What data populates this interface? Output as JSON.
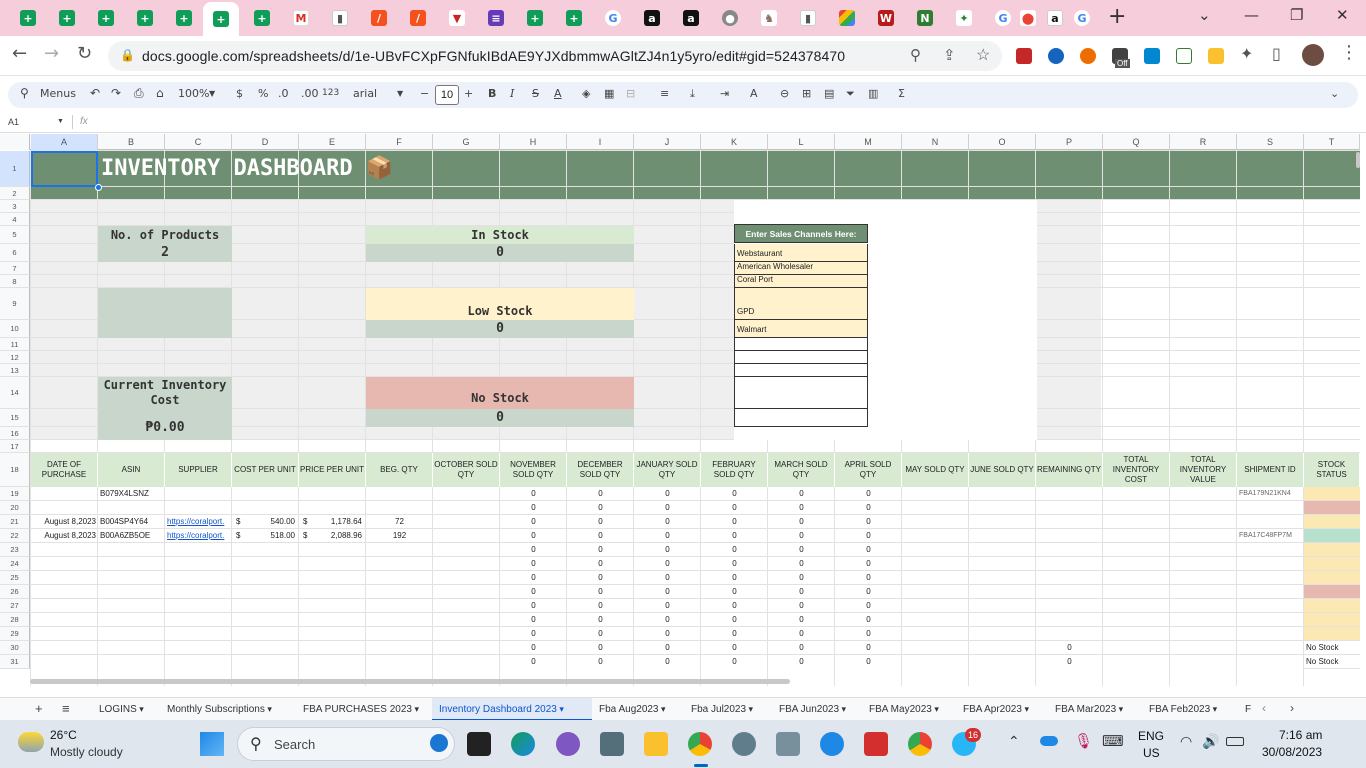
{
  "browser": {
    "url": "docs.google.com/spreadsheets/d/1e-UBvFCXpFGNfukIBdAE9YJXdbmmwAGltZJ4n1y5yro/edit#gid=524378470",
    "extension_badge": "Off"
  },
  "toolbar": {
    "search_label": "Menus",
    "zoom": "100%",
    "currency": "$",
    "percent": "%",
    "dec_decrease": ".0",
    "dec_increase": ".00",
    "number_format": "123",
    "font": "arial",
    "font_size": "10",
    "bold": "B",
    "italic": "I",
    "sum": "Σ"
  },
  "formula_bar": {
    "cell_ref": "A1",
    "fx": "fx"
  },
  "columns": [
    "A",
    "B",
    "C",
    "D",
    "E",
    "F",
    "G",
    "H",
    "I",
    "J",
    "K",
    "L",
    "M",
    "N",
    "O",
    "P",
    "Q",
    "R",
    "S",
    "T"
  ],
  "rows": [
    "1",
    "2",
    "3",
    "4",
    "5",
    "6",
    "7",
    "8",
    "9",
    "10",
    "11",
    "12",
    "13",
    "14",
    "15",
    "16",
    "17",
    "18",
    "19",
    "20",
    "21",
    "22",
    "23",
    "24",
    "25",
    "26",
    "27",
    "28",
    "29",
    "30",
    "31"
  ],
  "dashboard": {
    "title": "INVENTORY DASHBOARD 📦",
    "products_label": "No. of Products",
    "products_value": "2",
    "in_stock_label": "In Stock",
    "in_stock_value": "0",
    "low_stock_label": "Low Stock",
    "low_stock_value": "0",
    "cost_label": "Current Inventory Cost",
    "cost_value": "₱0.00",
    "no_stock_label": "No Stock",
    "no_stock_value": "0",
    "channels_header": "Enter Sales Channels Here:",
    "channels": [
      "Webstaurant",
      "American Wholesaler",
      "Coral Port",
      "GPD",
      "Walmart",
      "",
      "",
      "",
      "",
      ""
    ]
  },
  "table": {
    "headers": [
      "DATE OF PURCHASE",
      "ASIN",
      "SUPPLIER",
      "COST PER UNIT",
      "PRICE PER UNIT",
      "BEG. QTY",
      "OCTOBER SOLD QTY",
      "NOVEMBER SOLD QTY",
      "DECEMBER SOLD QTY",
      "JANUARY SOLD QTY",
      "FEBRUARY SOLD QTY",
      "MARCH SOLD QTY",
      "APRIL SOLD QTY",
      "MAY SOLD QTY",
      "JUNE SOLD QTY",
      "REMAINING QTY",
      "TOTAL INVENTORY COST",
      "TOTAL INVENTORY VALUE",
      "SHIPMENT ID",
      "STOCK STATUS"
    ],
    "rows": [
      {
        "date": "",
        "asin": "B079X4LSNZ",
        "supplier": "",
        "cost": "",
        "price": "",
        "beg": "",
        "zeros": "0",
        "remaining": "",
        "shipment": "FBA179N21KN4",
        "status": "",
        "status_color": "#fce8b2"
      },
      {
        "date": "",
        "asin": "",
        "supplier": "",
        "cost": "",
        "price": "",
        "beg": "",
        "zeros": "0",
        "remaining": "",
        "shipment": "",
        "status": "",
        "status_color": "#e6b8af"
      },
      {
        "date": "August 8,2023",
        "asin": "B004SP4Y64",
        "supplier": "https://coralport.",
        "cost": "540.00",
        "price": "1,178.64",
        "beg": "72",
        "zeros": "0",
        "remaining": "",
        "shipment": "",
        "status": "",
        "status_color": "#fce8b2"
      },
      {
        "date": "August 8,2023",
        "asin": "B00A6ZB5OE",
        "supplier": "https://coralport.",
        "cost": "518.00",
        "price": "2,088.96",
        "beg": "192",
        "zeros": "0",
        "remaining": "",
        "shipment": "FBA17C48FP7M",
        "status": "",
        "status_color": "#b7e1cd"
      },
      {
        "date": "",
        "asin": "",
        "supplier": "",
        "cost": "",
        "price": "",
        "beg": "",
        "zeros": "0",
        "remaining": "",
        "shipment": "",
        "status": "",
        "status_color": "#fce8b2"
      },
      {
        "date": "",
        "asin": "",
        "supplier": "",
        "cost": "",
        "price": "",
        "beg": "",
        "zeros": "0",
        "remaining": "",
        "shipment": "",
        "status": "",
        "status_color": "#fce8b2"
      },
      {
        "date": "",
        "asin": "",
        "supplier": "",
        "cost": "",
        "price": "",
        "beg": "",
        "zeros": "0",
        "remaining": "",
        "shipment": "",
        "status": "",
        "status_color": "#fce8b2"
      },
      {
        "date": "",
        "asin": "",
        "supplier": "",
        "cost": "",
        "price": "",
        "beg": "",
        "zeros": "0",
        "remaining": "",
        "shipment": "",
        "status": "",
        "status_color": "#e6b8af"
      },
      {
        "date": "",
        "asin": "",
        "supplier": "",
        "cost": "",
        "price": "",
        "beg": "",
        "zeros": "0",
        "remaining": "",
        "shipment": "",
        "status": "",
        "status_color": "#fce8b2"
      },
      {
        "date": "",
        "asin": "",
        "supplier": "",
        "cost": "",
        "price": "",
        "beg": "",
        "zeros": "0",
        "remaining": "",
        "shipment": "",
        "status": "",
        "status_color": "#fce8b2"
      },
      {
        "date": "",
        "asin": "",
        "supplier": "",
        "cost": "",
        "price": "",
        "beg": "",
        "zeros": "0",
        "remaining": "",
        "shipment": "",
        "status": "",
        "status_color": "#fce8b2"
      },
      {
        "date": "",
        "asin": "",
        "supplier": "",
        "cost": "",
        "price": "",
        "beg": "",
        "zeros": "0",
        "remaining": "0",
        "shipment": "",
        "status": "No Stock",
        "status_color": "#ffffff"
      },
      {
        "date": "",
        "asin": "",
        "supplier": "",
        "cost": "",
        "price": "",
        "beg": "",
        "zeros": "0",
        "remaining": "0",
        "shipment": "",
        "status": "No Stock",
        "status_color": "#ffffff"
      }
    ]
  },
  "sheet_tabs": [
    "LOGINS",
    "Monthly Subscriptions",
    "FBA PURCHASES 2023",
    "Inventory Dashboard 2023",
    "Fba Aug2023",
    "Fba Jul2023",
    "FBA Jun2023",
    "FBA May2023",
    "FBA Apr2023",
    "FBA Mar2023",
    "FBA Feb2023",
    "F"
  ],
  "active_sheet": "Inventory Dashboard 2023",
  "taskbar": {
    "temp": "26°C",
    "weather": "Mostly cloudy",
    "search": "Search",
    "lang1": "ENG",
    "lang2": "US",
    "time": "7:16 am",
    "date": "30/08/2023",
    "badge": "16"
  },
  "colors": {
    "header_green": "#6f8f72",
    "light_green": "#d9ead3",
    "sage": "#c9d6cc",
    "yellow": "#fff2cc",
    "red": "#e6b8af",
    "tab_pink": "#f6cdda"
  }
}
